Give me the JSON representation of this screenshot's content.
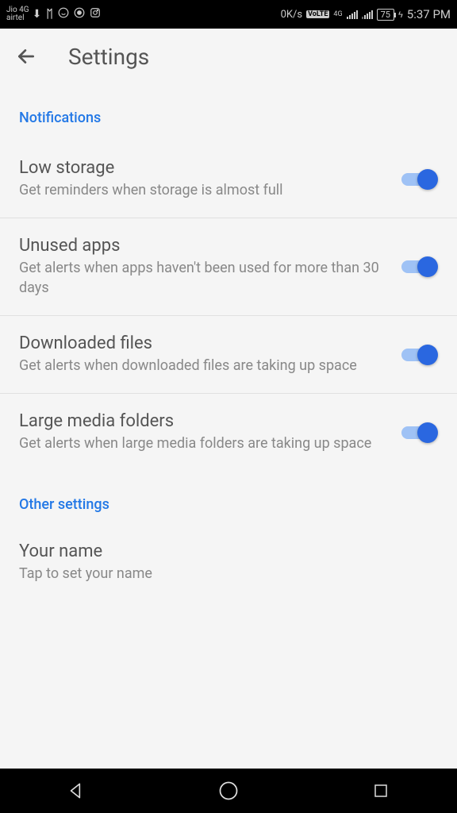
{
  "status_bar": {
    "carrier_line1": "Jio 4G",
    "carrier_line2": "airtel",
    "data_rate": "0K/s",
    "volte": "VoLTE",
    "network_badge": "4G",
    "battery": "75",
    "time": "5:37 PM"
  },
  "header": {
    "title": "Settings"
  },
  "sections": {
    "notifications": {
      "header": "Notifications",
      "items": [
        {
          "title": "Low storage",
          "subtitle": "Get reminders when storage is almost full",
          "on": true
        },
        {
          "title": "Unused apps",
          "subtitle": "Get alerts when apps haven't been used for more than 30 days",
          "on": true
        },
        {
          "title": "Downloaded files",
          "subtitle": "Get alerts when downloaded files are taking up space",
          "on": true
        },
        {
          "title": "Large media folders",
          "subtitle": "Get alerts when large media folders are taking up space",
          "on": true
        }
      ]
    },
    "other": {
      "header": "Other settings",
      "items": [
        {
          "title": "Your name",
          "subtitle": "Tap to set your name"
        }
      ]
    }
  }
}
